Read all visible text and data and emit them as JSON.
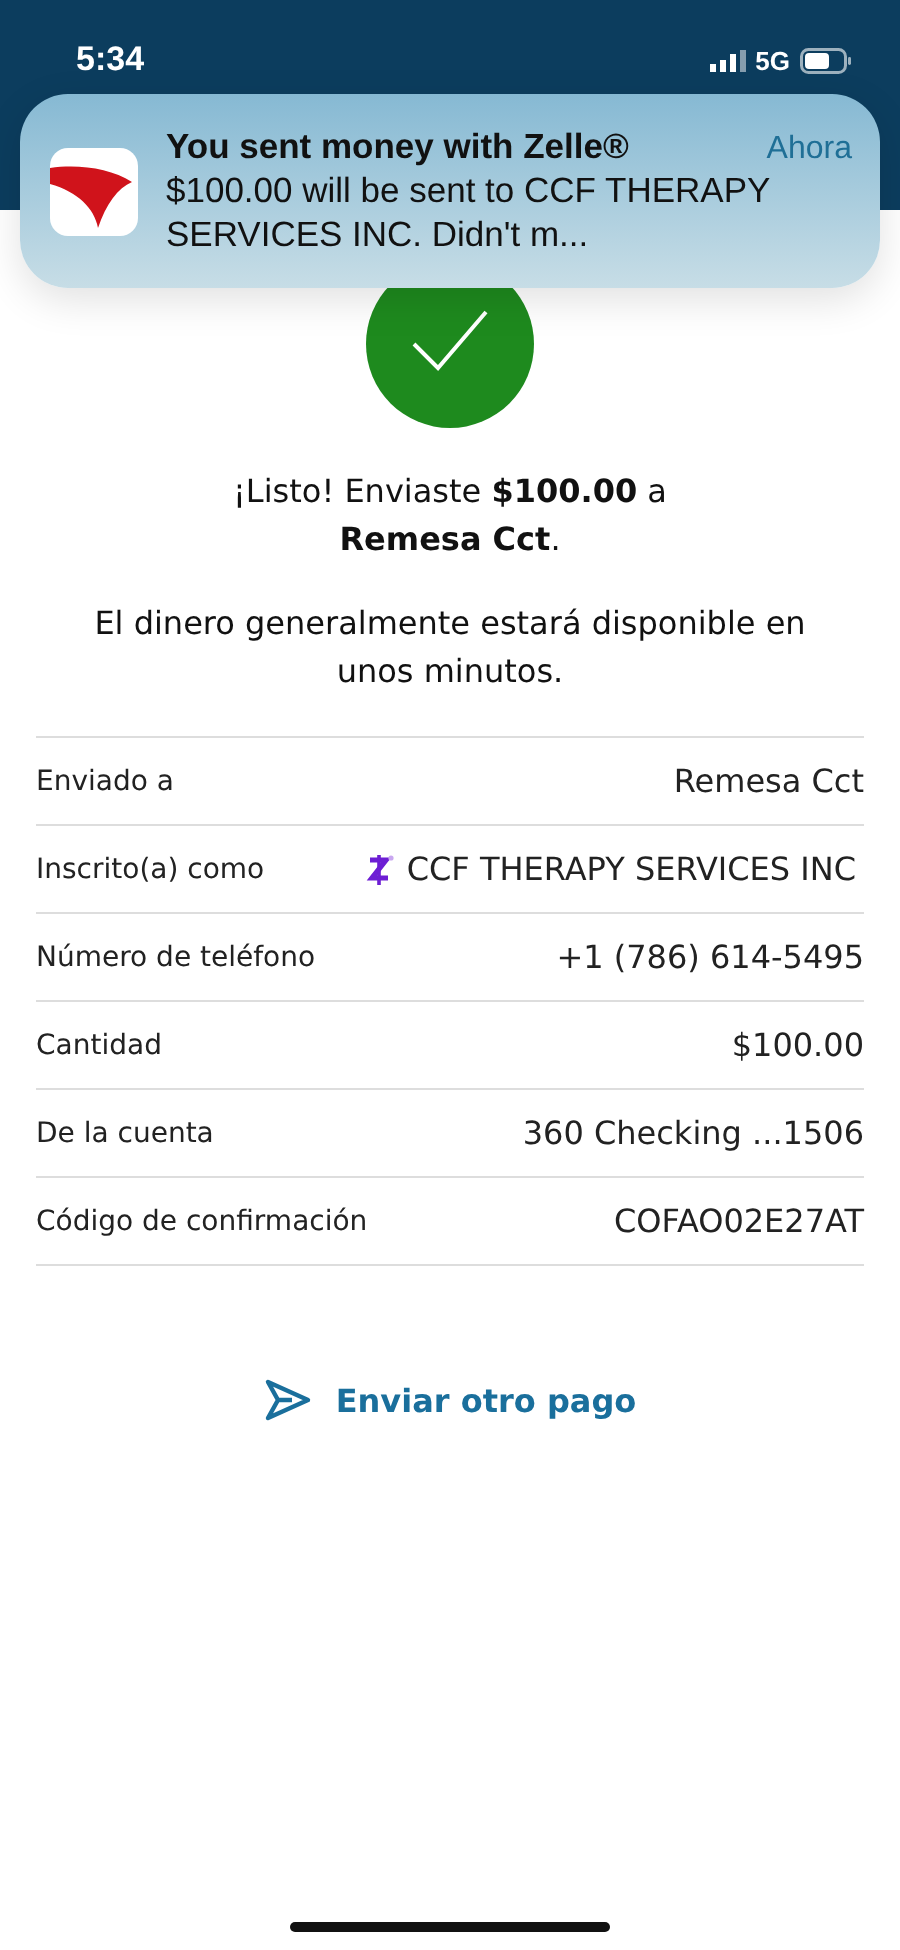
{
  "status_bar": {
    "time": "5:34",
    "network": "5G"
  },
  "notification": {
    "title": "You sent money with Zelle®",
    "time": "Ahora",
    "body": "$100.00 will be sent to CCF THERAPY SERVICES INC. Didn't m..."
  },
  "confirmation": {
    "headline": "¡Listo! Enviaste **$100.00** a **Remesa Cct**.",
    "note": "El dinero generalmente estará disponible en unos minutos."
  },
  "details": [
    {
      "label": "Enviado a",
      "value": "Remesa Cct",
      "kind": "text"
    },
    {
      "label": "Inscrito(a) como",
      "value": "CCF THERAPY SERVICES INC",
      "kind": "zelle"
    },
    {
      "label": "Número de teléfono",
      "value": "+1 (786) 614-5495",
      "kind": "text"
    },
    {
      "label": "Cantidad",
      "value": "$100.00",
      "kind": "text"
    },
    {
      "label": "De la cuenta",
      "value": "360 Checking ...1506",
      "kind": "text"
    },
    {
      "label": "Código de confirmación",
      "value": "COFAO02E27AT",
      "kind": "text"
    }
  ],
  "action": {
    "label": "Enviar otro pago"
  }
}
